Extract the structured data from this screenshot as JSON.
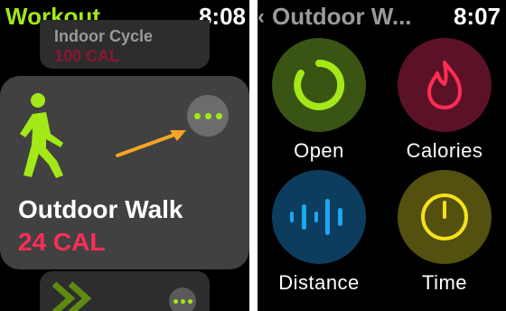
{
  "left": {
    "app_title": "Workout",
    "time": "8:08",
    "previous_workout": {
      "name": "Indoor Cycle",
      "calories": "100 CAL"
    },
    "selected_workout": {
      "name": "Outdoor Walk",
      "calories": "24 CAL",
      "icon": "walking-figure-icon"
    },
    "more_button_icon": "ellipsis-icon",
    "next_workout": {
      "icon": "double-chevron-right-icon"
    }
  },
  "right": {
    "back_icon": "chevron-left-icon",
    "title": "Outdoor W...",
    "time": "8:07",
    "goals": [
      {
        "label": "Open",
        "icon": "ring-icon",
        "color": "#a3e817"
      },
      {
        "label": "Calories",
        "icon": "flame-icon",
        "color": "#ff2d55"
      },
      {
        "label": "Distance",
        "icon": "distance-bars-icon",
        "color": "#1aa8f0"
      },
      {
        "label": "Time",
        "icon": "stopwatch-icon",
        "color": "#f5e11a"
      }
    ]
  },
  "colors": {
    "accent_green": "#a3e817",
    "calorie_red": "#ff2d55",
    "arrow_orange": "#f5a623"
  }
}
